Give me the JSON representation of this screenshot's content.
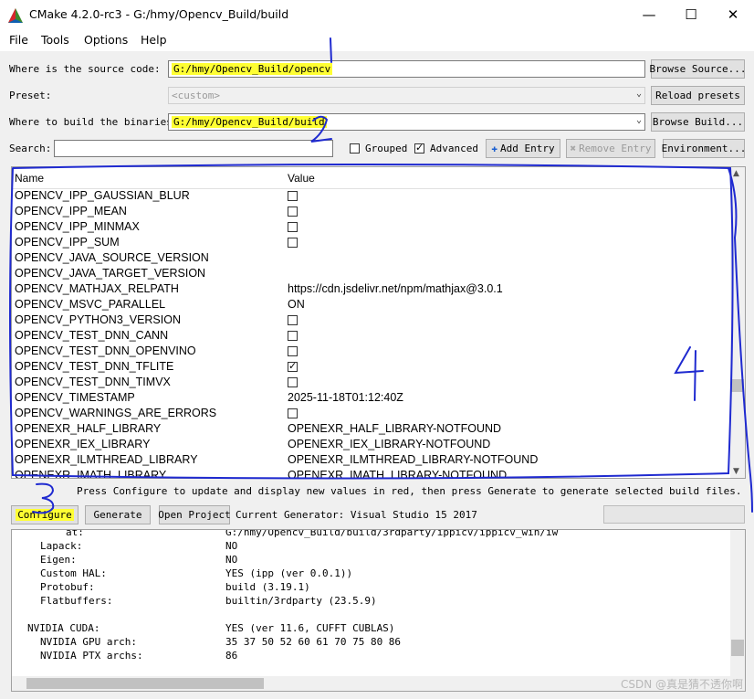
{
  "window": {
    "title": "CMake 4.2.0-rc3 - G:/hmy/Opencv_Build/build",
    "minimize": "—",
    "maximize": "☐",
    "close": "✕"
  },
  "menu": [
    "File",
    "Tools",
    "Options",
    "Help"
  ],
  "source": {
    "label": "Where is the source code:",
    "value": "G:/hmy/Opencv_Build/opencv",
    "button": "Browse Source..."
  },
  "preset": {
    "label": "Preset:",
    "value": "<custom>",
    "button": "Reload presets"
  },
  "binaries": {
    "label": "Where to build the binaries:",
    "value": "G:/hmy/Opencv_Build/build",
    "button": "Browse Build..."
  },
  "search": {
    "label": "Search:",
    "value": "",
    "grouped_label": "Grouped",
    "grouped": false,
    "advanced_label": "Advanced",
    "advanced": true,
    "add_entry": "Add Entry",
    "remove_entry": "Remove Entry",
    "environment": "Environment..."
  },
  "table": {
    "headers": [
      "Name",
      "Value"
    ],
    "rows": [
      {
        "name": "OPENCV_IPP_GAUSSIAN_BLUR",
        "type": "bool",
        "checked": false
      },
      {
        "name": "OPENCV_IPP_MEAN",
        "type": "bool",
        "checked": false
      },
      {
        "name": "OPENCV_IPP_MINMAX",
        "type": "bool",
        "checked": false
      },
      {
        "name": "OPENCV_IPP_SUM",
        "type": "bool",
        "checked": false
      },
      {
        "name": "OPENCV_JAVA_SOURCE_VERSION",
        "type": "text",
        "value": ""
      },
      {
        "name": "OPENCV_JAVA_TARGET_VERSION",
        "type": "text",
        "value": ""
      },
      {
        "name": "OPENCV_MATHJAX_RELPATH",
        "type": "text",
        "value": "https://cdn.jsdelivr.net/npm/mathjax@3.0.1"
      },
      {
        "name": "OPENCV_MSVC_PARALLEL",
        "type": "text",
        "value": "ON"
      },
      {
        "name": "OPENCV_PYTHON3_VERSION",
        "type": "bool",
        "checked": false
      },
      {
        "name": "OPENCV_TEST_DNN_CANN",
        "type": "bool",
        "checked": false
      },
      {
        "name": "OPENCV_TEST_DNN_OPENVINO",
        "type": "bool",
        "checked": false
      },
      {
        "name": "OPENCV_TEST_DNN_TFLITE",
        "type": "bool",
        "checked": true
      },
      {
        "name": "OPENCV_TEST_DNN_TIMVX",
        "type": "bool",
        "checked": false
      },
      {
        "name": "OPENCV_TIMESTAMP",
        "type": "text",
        "value": "2025-11-18T01:12:40Z"
      },
      {
        "name": "OPENCV_WARNINGS_ARE_ERRORS",
        "type": "bool",
        "checked": false
      },
      {
        "name": "OPENEXR_HALF_LIBRARY",
        "type": "text",
        "value": "OPENEXR_HALF_LIBRARY-NOTFOUND"
      },
      {
        "name": "OPENEXR_IEX_LIBRARY",
        "type": "text",
        "value": "OPENEXR_IEX_LIBRARY-NOTFOUND"
      },
      {
        "name": "OPENEXR_ILMTHREAD_LIBRARY",
        "type": "text",
        "value": "OPENEXR_ILMTHREAD_LIBRARY-NOTFOUND"
      },
      {
        "name": "OPENEXR_IMATH_LIBRARY",
        "type": "text",
        "value": "OPENEXR_IMATH_LIBRARY-NOTFOUND"
      }
    ]
  },
  "status_line": "Press Configure to update and display new values in red, then press Generate to generate selected build files.",
  "buttons": {
    "configure": "Configure",
    "generate": "Generate",
    "open_project": "Open Project"
  },
  "generator": "Current Generator: Visual Studio 15 2017",
  "output": [
    {
      "k": "at:",
      "v": "G:/hmy/Opencv_Build/build/3rdparty/ippicv/ippicv_win/iw",
      "indent": 3
    },
    {
      "k": "Lapack:",
      "v": "NO",
      "indent": 1
    },
    {
      "k": "Eigen:",
      "v": "NO",
      "indent": 1
    },
    {
      "k": "Custom HAL:",
      "v": "YES (ipp (ver 0.0.1))",
      "indent": 1
    },
    {
      "k": "Protobuf:",
      "v": "build (3.19.1)",
      "indent": 1
    },
    {
      "k": "Flatbuffers:",
      "v": "builtin/3rdparty (23.5.9)",
      "indent": 1
    },
    {
      "k": "",
      "v": "",
      "indent": 0
    },
    {
      "k": "NVIDIA CUDA:",
      "v": "YES (ver 11.6, CUFFT CUBLAS)",
      "indent": 0
    },
    {
      "k": "NVIDIA GPU arch:",
      "v": "35 37 50 52 60 61 70 75 80 86",
      "indent": 1
    },
    {
      "k": "NVIDIA PTX archs:",
      "v": "86",
      "indent": 1
    }
  ],
  "annotations": [
    "1",
    "2",
    "3",
    "4"
  ],
  "watermark": "CSDN @真是猜不透你啊",
  "colors": {
    "highlight": "#ffff33",
    "annotation_ink": "#1f2ad0",
    "checkbox_tick": "#000000"
  }
}
